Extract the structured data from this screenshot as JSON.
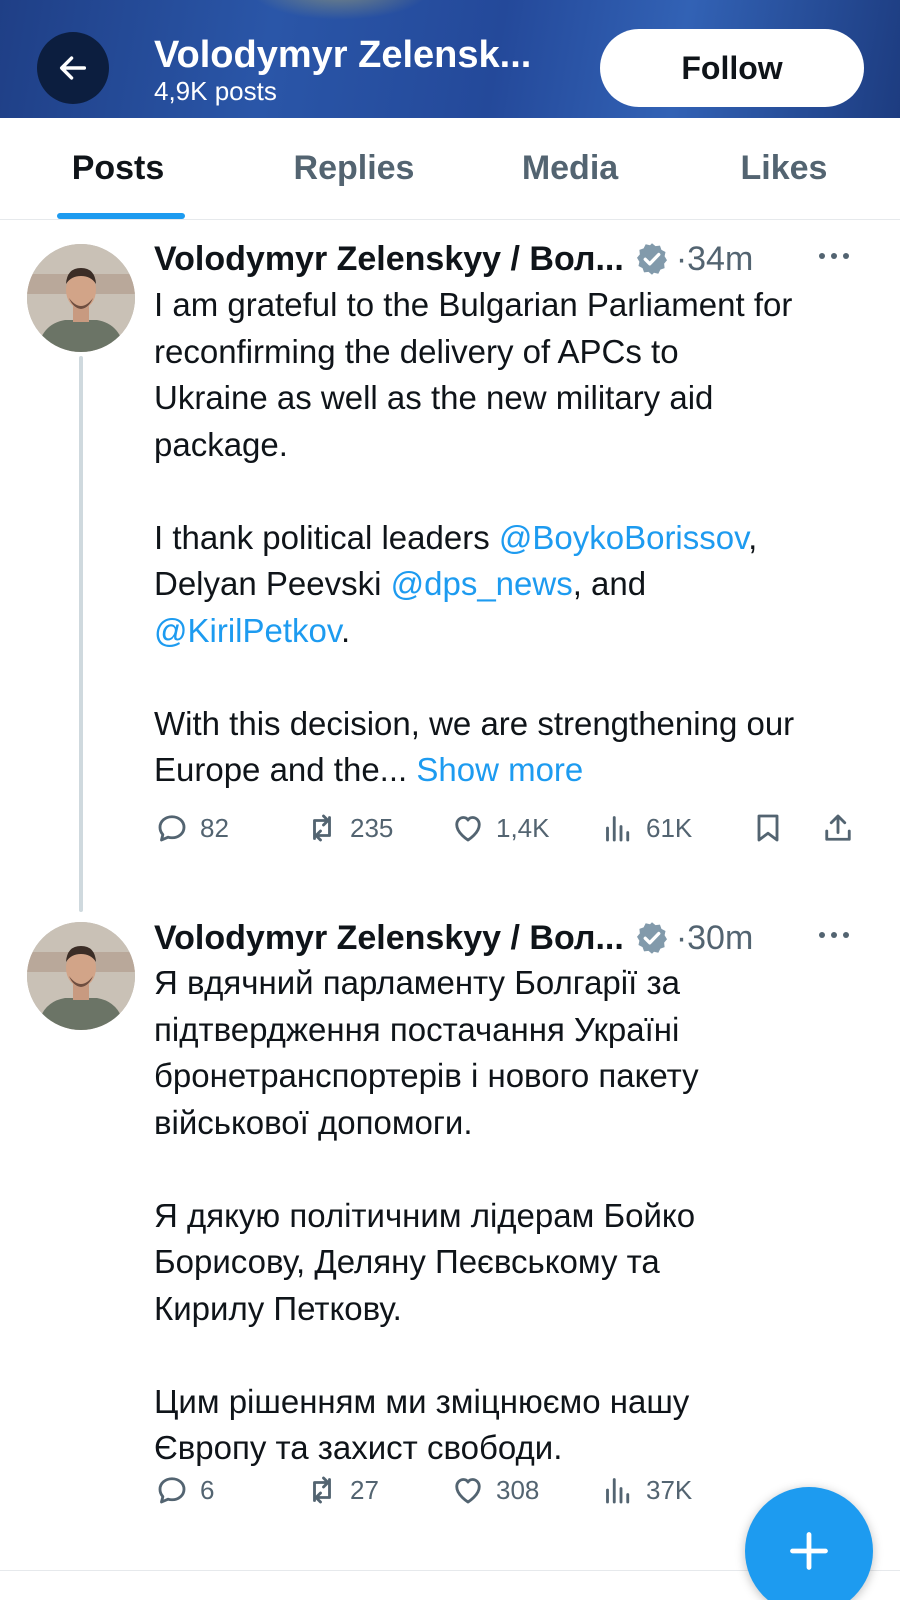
{
  "header": {
    "title": "Volodymyr Zelensk...",
    "posts_count": "4,9K posts",
    "follow_label": "Follow"
  },
  "tabs": [
    {
      "label": "Posts",
      "active": true
    },
    {
      "label": "Replies",
      "active": false
    },
    {
      "label": "Media",
      "active": false
    },
    {
      "label": "Likes",
      "active": false
    }
  ],
  "posts": [
    {
      "author": "Volodymyr Zelenskyy / Вол...",
      "time": "·34m",
      "text": {
        "p1_l1": "I am grateful to the Bulgarian Parliament for",
        "p1_l2": "reconfirming the delivery of APCs to",
        "p1_l3": "Ukraine as well as the new military aid",
        "p1_l4": "package.",
        "p2_l1_pre": "I thank political leaders ",
        "p2_l1_mention": "@BoykoBorissov",
        "p2_l1_post": ",",
        "p2_l2_pre": "Delyan Peevski ",
        "p2_l2_mention": "@dps_news",
        "p2_l2_post": ", and",
        "p2_l3_mention": "@KirilPetkov",
        "p2_l3_post": ".",
        "p3_l1": "With this decision, we are strengthening our",
        "p3_l2": "Europe and the... ",
        "show_more": "Show more"
      },
      "stats": {
        "replies": "82",
        "reposts": "235",
        "likes": "1,4K",
        "views": "61K"
      }
    },
    {
      "author": "Volodymyr Zelenskyy / Вол...",
      "time": "·30m",
      "text": {
        "p1_l1": "Я вдячний парламенту Болгарії за",
        "p1_l2": "підтвердження постачання Україні",
        "p1_l3": "бронетранспортерів і нового пакету",
        "p1_l4": "військової допомоги.",
        "p2_l1": "Я дякую політичним лідерам Бойко",
        "p2_l2": "Борисову, Деляну Пеєвському та",
        "p2_l3": "Кирилу Петкову.",
        "p3_l1": "Цим рішенням ми зміцнюємо нашу",
        "p3_l2": "Європу та захист свободи."
      },
      "stats": {
        "replies": "6",
        "reposts": "27",
        "likes": "308",
        "views": "37K"
      }
    }
  ],
  "colors": {
    "accent": "#1d9bf0",
    "header_bg": "#24499a",
    "muted": "#536471"
  },
  "icons": {
    "back": "arrow-left-icon",
    "verified": "verified-badge-icon",
    "more": "more-dots-icon",
    "reply": "reply-icon",
    "repost": "repost-icon",
    "like": "heart-icon",
    "views": "views-icon",
    "bookmark": "bookmark-icon",
    "share": "share-icon",
    "compose": "plus-icon"
  }
}
